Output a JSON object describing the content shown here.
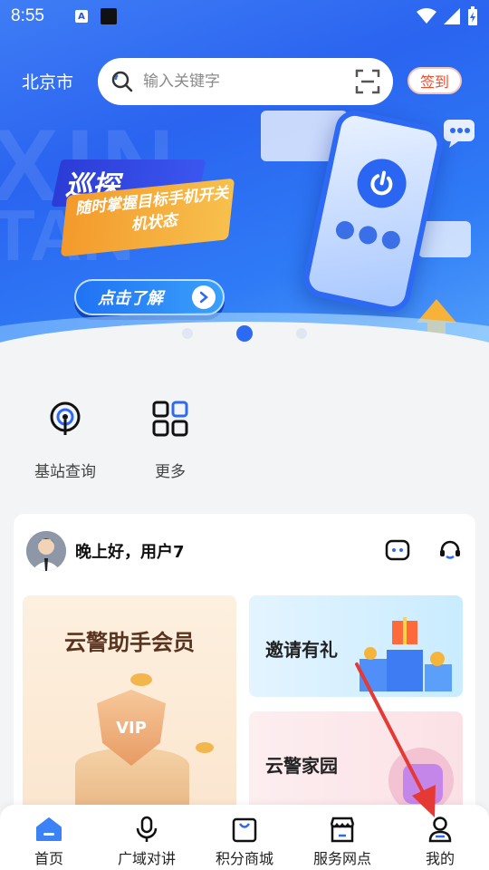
{
  "status_bar": {
    "time": "8:55",
    "icon_a": "A"
  },
  "header": {
    "city": "北京市",
    "search_placeholder": "输入关键字",
    "signin_label": "签到"
  },
  "banner": {
    "ghost_text": "XIN",
    "ghost_text2": "TAN",
    "title": "巡探",
    "subtitle": "随时掌握目标手机开关机状态",
    "button_label": "点击了解",
    "slide_count": 3,
    "active_slide": 2
  },
  "quick_actions": [
    {
      "label": "基站查询",
      "icon": "antenna-icon"
    },
    {
      "label": "更多",
      "icon": "grid-more-icon"
    }
  ],
  "member_card": {
    "greeting": "晚上好，用户7",
    "vip_title": "云警助手会员",
    "vip_badge": "VIP",
    "invite_title": "邀请有礼",
    "home_title": "云警家园"
  },
  "bottom_nav": [
    {
      "label": "首页",
      "icon": "home-icon",
      "active": true
    },
    {
      "label": "广域对讲",
      "icon": "microphone-icon",
      "active": false
    },
    {
      "label": "积分商城",
      "icon": "shopping-bag-icon",
      "active": false
    },
    {
      "label": "服务网点",
      "icon": "store-icon",
      "active": false
    },
    {
      "label": "我的",
      "icon": "user-icon",
      "active": false
    }
  ],
  "colors": {
    "brand_blue": "#2d6af3",
    "signin_red": "#f04b2a",
    "annotation_red": "#e53935"
  }
}
